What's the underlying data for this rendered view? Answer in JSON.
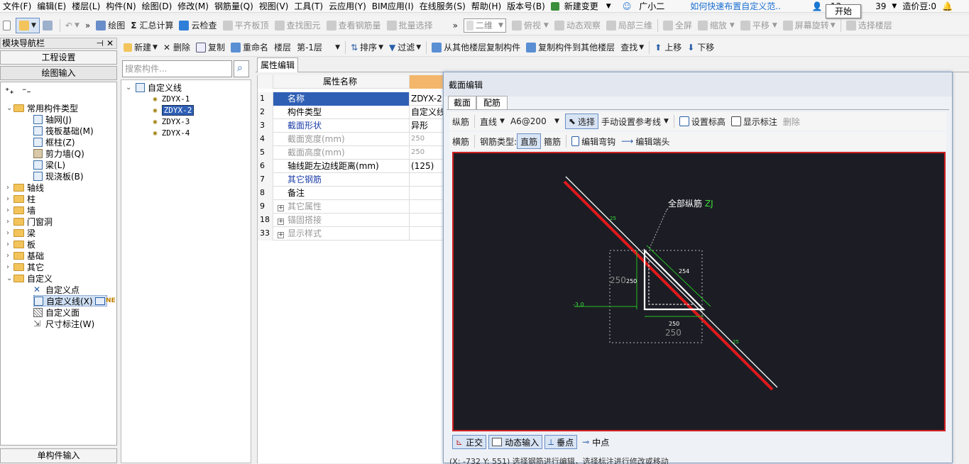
{
  "menubar": {
    "items": [
      "文件(F)",
      "编辑(E)",
      "楼层(L)",
      "构件(N)",
      "绘图(D)",
      "修改(M)",
      "钢筋量(Q)",
      "视图(V)",
      "工具(T)",
      "云应用(Y)",
      "BIM应用(I)",
      "在线服务(S)",
      "帮助(H)",
      "版本号(B)"
    ],
    "new_change": "新建变更",
    "assistant": "广小二",
    "help_link": "如何快速布置自定义范..",
    "user": "13",
    "user_suffix": "39",
    "beans": "造价豆:0",
    "tooltip": "开始"
  },
  "toolbar": {
    "draw": "绘图",
    "sum": "汇总计算",
    "cloud_check": "云检查",
    "align_top": "平齐板顶",
    "find_element": "查找图元",
    "view_rebar": "查看钢筋量",
    "batch_select": "批量选择",
    "view_mode": "二维",
    "top_view": "俯视",
    "dynamic_view": "动态观察",
    "local_3d": "局部三维",
    "fullscreen": "全屏",
    "zoom": "缩放",
    "pan": "平移",
    "rotate": "屏幕旋转",
    "select_floor": "选择楼层"
  },
  "nav": {
    "title": "模块导航栏",
    "project_settings": "工程设置",
    "drawing_input": "绘图输入",
    "single_input": "单构件输入",
    "tree": {
      "common": "常用构件类型",
      "common_items": [
        "轴网(J)",
        "筏板基础(M)",
        "框柱(Z)",
        "剪力墙(Q)",
        "梁(L)",
        "现浇板(B)"
      ],
      "folders": [
        "轴线",
        "柱",
        "墙",
        "门窗洞",
        "梁",
        "板",
        "基础",
        "其它"
      ],
      "custom": "自定义",
      "custom_items": [
        "自定义点",
        "自定义线(X)",
        "自定义面",
        "尺寸标注(W)"
      ],
      "ne_badge": "NE"
    }
  },
  "main_toolbar": {
    "new": "新建",
    "delete": "删除",
    "copy": "复制",
    "rename": "重命名",
    "floor_label": "楼层",
    "floor_value": "第-1层",
    "sort": "排序",
    "filter": "过滤",
    "copy_from": "从其他楼层复制构件",
    "copy_to": "复制构件到其他楼层",
    "find": "查找",
    "move_up": "上移",
    "move_down": "下移"
  },
  "search": {
    "placeholder": "搜索构件..."
  },
  "component_tree": {
    "root": "自定义线",
    "items": [
      "ZDYX-1",
      "ZDYX-2",
      "ZDYX-3",
      "ZDYX-4"
    ]
  },
  "property": {
    "tab": "属性编辑",
    "header": "属性名称",
    "rows": [
      {
        "no": "1",
        "name": "名称",
        "value": "ZDYX-2"
      },
      {
        "no": "2",
        "name": "构件类型",
        "value": "自定义线"
      },
      {
        "no": "3",
        "name": "截面形状",
        "value": "异形"
      },
      {
        "no": "4",
        "name": "截面宽度(mm)",
        "value": "250"
      },
      {
        "no": "5",
        "name": "截面高度(mm)",
        "value": "250"
      },
      {
        "no": "6",
        "name": "轴线距左边线距离(mm)",
        "value": "(125)"
      },
      {
        "no": "7",
        "name": "其它钢筋",
        "value": ""
      },
      {
        "no": "8",
        "name": "备注",
        "value": ""
      },
      {
        "no": "9",
        "name": "其它属性",
        "value": ""
      },
      {
        "no": "18",
        "name": "锚固搭接",
        "value": ""
      },
      {
        "no": "33",
        "name": "显示样式",
        "value": ""
      }
    ]
  },
  "dialog": {
    "title": "截面编辑",
    "tabs": [
      "截面",
      "配筋"
    ],
    "row1": {
      "long_rebar": "纵筋",
      "line": "直线",
      "spec": "A6@200",
      "select": "选择",
      "manual_ref": "手动设置参考线",
      "set_elev": "设置标高",
      "show_label": "显示标注",
      "delete": "删除"
    },
    "row2": {
      "transverse": "横筋",
      "rebar_type": "钢筋类型:",
      "straight": "直筋",
      "stirrup": "箍筋",
      "edit_hook": "编辑弯钩",
      "edit_end": "编辑端头"
    },
    "canvas": {
      "annotation": "全部纵筋",
      "annotation_code": "ZJ",
      "dim_250_left": "250",
      "dim_250_left_inner": "250",
      "dim_254": "254",
      "dim_250_bottom": "250",
      "dim_250_bottom_outer": "250",
      "elev": "-3.0",
      "tick_a": "25",
      "tick_b": "25"
    },
    "bottom": {
      "ortho": "正交",
      "dynamic_input": "动态输入",
      "perpendicular": "垂点",
      "midpoint": "中点"
    },
    "status": "(X: -732 Y: 551)    选择钢筋进行编辑，选择标注进行修改或移动"
  }
}
